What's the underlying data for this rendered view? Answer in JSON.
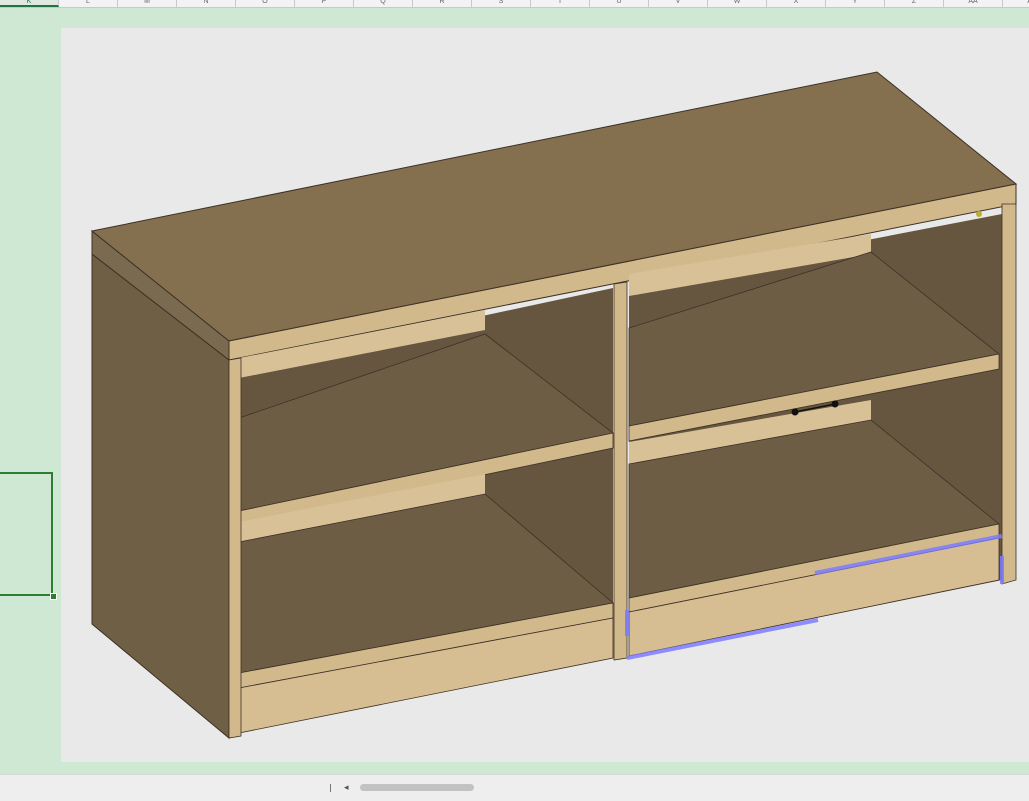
{
  "spreadsheet": {
    "column_headers": [
      "K",
      "L",
      "M",
      "N",
      "O",
      "P",
      "Q",
      "R",
      "S",
      "T",
      "U",
      "V",
      "W",
      "X",
      "Y",
      "Z",
      "AA",
      "AB"
    ],
    "active_column": "K"
  },
  "image": {
    "subject": "shelving-cabinet-3d-render",
    "colors": {
      "background": "#e9e9e9",
      "wood_top": "#84704f",
      "wood_side": "#6f5f45",
      "wood_edge": "#d2b98c",
      "wood_interior": "#6a5a42",
      "selection_highlight": "#7b7bff"
    }
  },
  "selection": {
    "color": "#2e7d32"
  },
  "icons": {
    "scroll_left": "◂"
  }
}
